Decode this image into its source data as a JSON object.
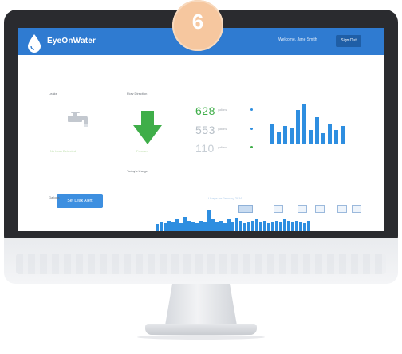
{
  "step_badge": "6",
  "app": {
    "brand": "EyeOnWater",
    "welcome": "Welcome, Jane Smith",
    "signout_label": "Sign Out"
  },
  "panels": {
    "leaks_label": "Leaks",
    "flow_label": "Flow Direction",
    "leak_note": "No Leak Detected",
    "flow_note": "Forward",
    "leak_alert_button": "Set Leak Alert",
    "usage_label": "Today's Usage",
    "gallons_label": "Gallons",
    "chart_title": "Usage for January 2016"
  },
  "stats": [
    {
      "value": "628",
      "label": "gallons",
      "color": "#3fae49"
    },
    {
      "value": "553",
      "label": "gallons",
      "color": "#b8c0c8"
    },
    {
      "value": "110",
      "label": "gallons",
      "color": "#c7ced5"
    }
  ],
  "chart_data": [
    {
      "type": "bar",
      "values": [
        22,
        14,
        20,
        18,
        38,
        44,
        16,
        30,
        12,
        22,
        16,
        20
      ],
      "color": "#2e8ee0"
    },
    {
      "type": "bar",
      "values": [
        6,
        8,
        7,
        9,
        8,
        10,
        7,
        12,
        9,
        8,
        7,
        9,
        8,
        18,
        10,
        8,
        9,
        7,
        10,
        8,
        11,
        9,
        7,
        8,
        9,
        10,
        8,
        9,
        7,
        8,
        9,
        8,
        10,
        9,
        8,
        9,
        8,
        7,
        9
      ],
      "color": "#2e8ee0"
    }
  ],
  "colors": {
    "accent": "#2f7bd1",
    "bezel": "#2a2b2f",
    "arrow_green": "#3fae49",
    "badge": "#f6c79f"
  },
  "icons": {
    "logo": "water-drop-icon",
    "leak": "faucet-icon",
    "flow": "arrow-down-icon"
  }
}
